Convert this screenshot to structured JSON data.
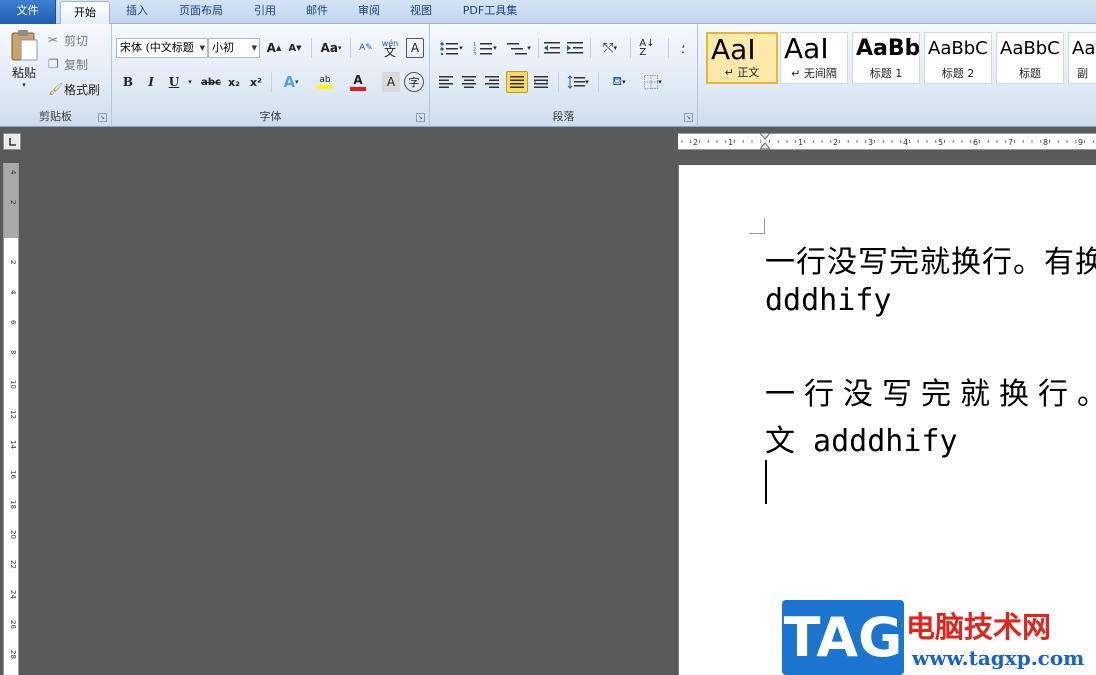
{
  "tabs": {
    "file": "文件",
    "home": "开始",
    "insert": "插入",
    "layout": "页面布局",
    "references": "引用",
    "mailings": "邮件",
    "review": "审阅",
    "view": "视图",
    "pdf": "PDF工具集"
  },
  "clipboard": {
    "paste": "粘贴",
    "cut": "剪切",
    "copy": "复制",
    "format_painter": "格式刷",
    "group_label": "剪贴板"
  },
  "font": {
    "font_name": "宋体 (中文标题",
    "font_size": "小初",
    "grow": "A",
    "shrink": "A",
    "change_case": "Aa",
    "phonetic": "wén",
    "char_border": "A",
    "bold": "B",
    "italic": "I",
    "underline": "U",
    "strike": "abc",
    "subscript": "x₂",
    "superscript": "x²",
    "text_effects": "A",
    "highlight": "ab",
    "font_color": "A",
    "char_shading": "A",
    "enclose": "字",
    "group_label": "字体"
  },
  "paragraph": {
    "group_label": "段落"
  },
  "styles": {
    "items": [
      {
        "preview": "AaI",
        "label": "↵ 正文"
      },
      {
        "preview": "AaI",
        "label": "↵ 无间隔"
      },
      {
        "preview": "AaBb",
        "label": "标题 1"
      },
      {
        "preview": "AaBbC",
        "label": "标题 2"
      },
      {
        "preview": "AaBbC",
        "label": "标题"
      },
      {
        "preview": "Aa",
        "label": "副"
      }
    ]
  },
  "hruler": {
    "ticks": [
      "2",
      "1",
      "1",
      "2",
      "3",
      "4",
      "5",
      "6",
      "7",
      "8",
      "9"
    ]
  },
  "vruler": {
    "ticks": [
      "4",
      "2",
      "2",
      "4",
      "6",
      "8",
      "10",
      "12",
      "14",
      "16",
      "18",
      "20",
      "22",
      "24",
      "26",
      "28"
    ]
  },
  "document": {
    "line1": "一行没写完就换行。有换",
    "line2": "dddhify",
    "line3": "一行没写完就换行。",
    "line4": "文 adddhify"
  },
  "watermark": {
    "logo": "TAG",
    "title": "电脑技术网",
    "url": "www.tagxp.com"
  },
  "colors": {
    "accent": "#1f5db4",
    "page_bg": "#5a5a5a",
    "highlight": "#ffd966"
  }
}
